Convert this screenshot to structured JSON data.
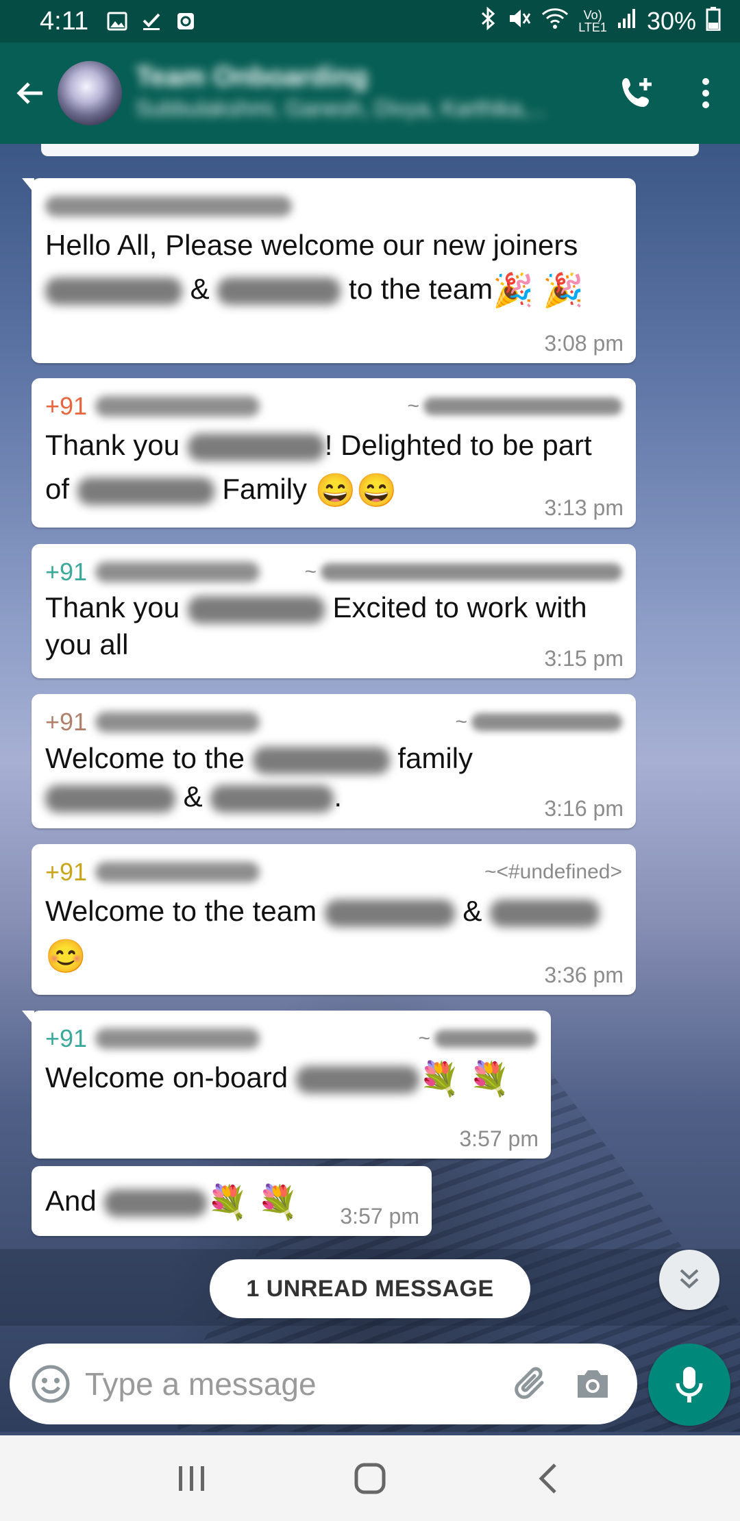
{
  "status_bar": {
    "time": "4:11",
    "battery": "30%",
    "network_top": "Vo)",
    "network_bottom": "LTE1",
    "icons": [
      "image-icon",
      "check-icon",
      "clock-app-icon",
      "bluetooth-icon",
      "mute-icon",
      "wifi-icon",
      "signal-icon",
      "battery-icon"
    ]
  },
  "header": {
    "group_name": "Team Onboarding",
    "members": "Subbulakshmi, Ganesh, Divya, Karthika,...",
    "icons": [
      "back-arrow-icon",
      "add-call-icon",
      "more-vert-icon"
    ]
  },
  "messages": [
    {
      "sender_phone": "",
      "sender_color": "#1b8a7a",
      "alias": "",
      "text_parts": [
        "Hello All, Please welcome our new joiners",
        " & ",
        " to the team"
      ],
      "emojis": "🎉 🎉",
      "time": "3:08 pm"
    },
    {
      "sender_phone": "+91",
      "sender_color": "#e8643c",
      "alias": "~",
      "text_parts": [
        "Thank you ",
        "! Delighted to be part of ",
        " Family "
      ],
      "emojis": "😄😄",
      "time": "3:13 pm"
    },
    {
      "sender_phone": "+91",
      "sender_color": "#3aa89a",
      "alias": "~",
      "text_parts": [
        "Thank you ",
        " Excited to work with you all"
      ],
      "time": "3:15 pm"
    },
    {
      "sender_phone": "+91",
      "sender_color": "#b0806a",
      "alias": "~",
      "text_parts": [
        "Welcome to the ",
        " family",
        " & ",
        "."
      ],
      "time": "3:16 pm"
    },
    {
      "sender_phone": "+91",
      "sender_color": "#c9a51a",
      "alias": "~<#undefined>",
      "text_parts": [
        "Welcome to the team ",
        " & "
      ],
      "emojis": "😊",
      "time": "3:36 pm"
    },
    {
      "sender_phone": "+91",
      "sender_color": "#3aa89a",
      "alias": "~",
      "text_parts": [
        "Welcome on-board "
      ],
      "emojis": "💐 💐",
      "time": "3:57 pm"
    },
    {
      "text_parts": [
        "And "
      ],
      "emojis": "💐 💐",
      "time": "3:57 pm"
    }
  ],
  "unread": {
    "label": "1 UNREAD MESSAGE"
  },
  "composer": {
    "placeholder": "Type a message",
    "icons": [
      "emoji-icon",
      "attach-icon",
      "camera-icon",
      "mic-icon"
    ]
  },
  "nav": {
    "icons": [
      "recents-icon",
      "home-icon",
      "back-icon"
    ]
  },
  "colors": {
    "app_bar": "#075e54",
    "status_bar": "#054d44",
    "mic_button": "#00897b"
  }
}
